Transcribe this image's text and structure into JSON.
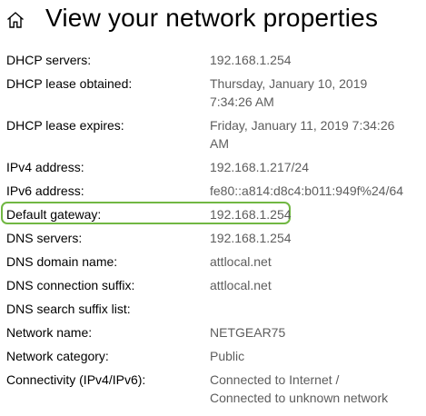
{
  "header": {
    "title": "View your network properties",
    "icon": "home-icon"
  },
  "properties": [
    {
      "label": "DHCP servers:",
      "value": [
        "192.168.1.254"
      ]
    },
    {
      "label": "DHCP lease obtained:",
      "value": [
        "Thursday, January 10, 2019",
        "7:34:26 AM"
      ]
    },
    {
      "label": "DHCP lease expires:",
      "value": [
        "Friday, January 11, 2019 7:34:26",
        "AM"
      ]
    },
    {
      "label": "IPv4 address:",
      "value": [
        "192.168.1.217/24"
      ]
    },
    {
      "label": "IPv6 address:",
      "value": [
        "fe80::a814:d8c4:b011:949f%24/64"
      ]
    },
    {
      "label": "Default gateway:",
      "value": [
        "192.168.1.254"
      ]
    },
    {
      "label": "DNS servers:",
      "value": [
        "192.168.1.254"
      ]
    },
    {
      "label": "DNS domain name:",
      "value": [
        "attlocal.net"
      ]
    },
    {
      "label": "DNS connection suffix:",
      "value": [
        "attlocal.net"
      ]
    },
    {
      "label": "DNS search suffix list:",
      "value": [
        ""
      ]
    },
    {
      "label": "Network name:",
      "value": [
        "NETGEAR75"
      ]
    },
    {
      "label": "Network category:",
      "value": [
        "Public"
      ]
    },
    {
      "label": "Connectivity (IPv4/IPv6):",
      "value": [
        "Connected to Internet /",
        "Connected to unknown network"
      ]
    }
  ],
  "highlight": {
    "row": "Default gateway:",
    "color": "#71b743"
  },
  "colors": {
    "label": "#000000",
    "value": "#5d5d5d"
  }
}
